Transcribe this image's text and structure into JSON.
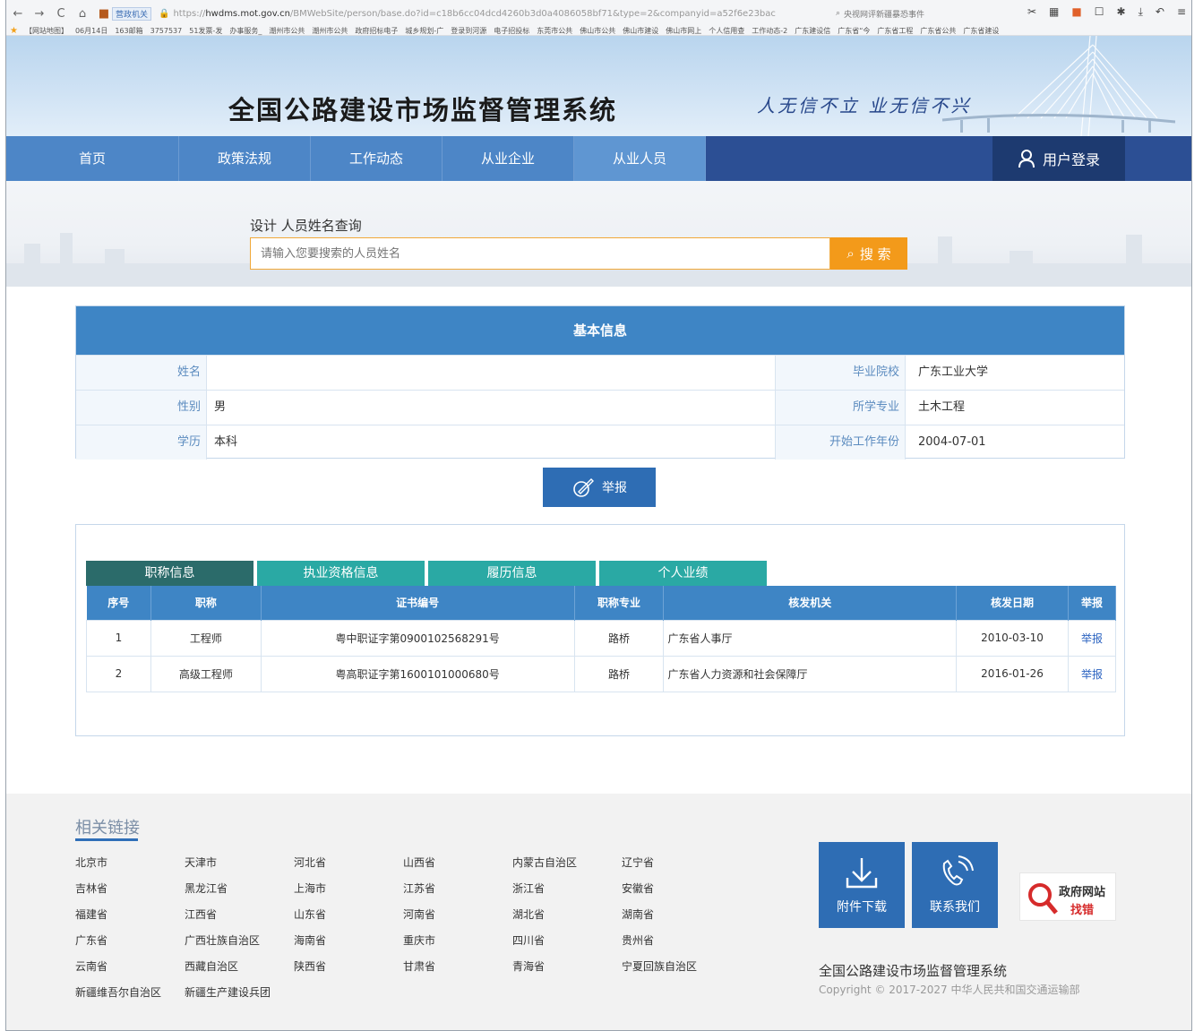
{
  "browser": {
    "url_tag": "营政机关",
    "url_prefix": "https://",
    "url_host": "hwdms.mot.gov.cn",
    "url_rest": "/BMWebSite/person/base.do?id=c18b6cc04dcd4260b3d0a4086058bf71&type=2&companyid=a52f6e23bac",
    "find_text": "央视网评新疆暴恐事件",
    "bookmarks": [
      "【网站地图】",
      "06月14日",
      "163邮箱",
      "3757537",
      "51发票-发",
      "办事服务_",
      "潮州市公共",
      "潮州市公共",
      "政府招标电子",
      "城乡规划-广",
      "登录到河源",
      "电子招投标",
      "东莞市公共",
      "佛山市公共",
      "佛山市建设",
      "佛山市网上",
      "个人信用查",
      "工作动态-2",
      "广东建设信",
      "广东省“今",
      "广东省工程",
      "广东省公共",
      "广东省建设"
    ],
    "colors": {
      "chrome": "#f4f5f7",
      "star": "#f3a11a"
    }
  },
  "header": {
    "title": "全国公路建设市场监督管理系统",
    "slogan": "人无信不立 业无信不兴"
  },
  "nav": {
    "items": [
      {
        "label": "首页"
      },
      {
        "label": "政策法规"
      },
      {
        "label": "工作动态"
      },
      {
        "label": "从业企业"
      },
      {
        "label": "从业人员"
      }
    ],
    "active": "从业人员",
    "login_label": "用户登录",
    "colors": {
      "bar": "#2c4f94",
      "item": "#4d86c7",
      "login": "#1d3a70"
    }
  },
  "search": {
    "label": "设计 人员姓名查询",
    "placeholder": "请输入您要搜索的人员姓名",
    "button_label": "搜 索",
    "colors": {
      "button": "#f39a1a",
      "border": "#f1a839"
    }
  },
  "basic_info": {
    "title": "基本信息",
    "rows": [
      {
        "left_label": "姓名",
        "left_value": "",
        "right_label": "毕业院校",
        "right_value": "广东工业大学"
      },
      {
        "left_label": "性别",
        "left_value": "男",
        "right_label": "所学专业",
        "right_value": "土木工程"
      },
      {
        "left_label": "学历",
        "left_value": "本科",
        "right_label": "开始工作年份",
        "right_value": "2004-07-01"
      }
    ],
    "report_button": "举报"
  },
  "detail_tabs": {
    "tabs": [
      {
        "label": "职称信息"
      },
      {
        "label": "执业资格信息"
      },
      {
        "label": "履历信息"
      },
      {
        "label": "个人业绩"
      }
    ],
    "active": "职称信息",
    "columns": [
      "序号",
      "职称",
      "证书编号",
      "职称专业",
      "核发机关",
      "核发日期",
      "举报"
    ],
    "rows": [
      {
        "no": "1",
        "title": "工程师",
        "cert_no": "粤中职证字第0900102568291号",
        "major": "路桥",
        "issuer": "广东省人事厅",
        "date": "2010-03-10",
        "report": "举报"
      },
      {
        "no": "2",
        "title": "高级工程师",
        "cert_no": "粤高职证字第1600101000680号",
        "major": "路桥",
        "issuer": "广东省人力资源和社会保障厅",
        "date": "2016-01-26",
        "report": "举报"
      }
    ],
    "colors": {
      "tab": "#2aa9a4",
      "tab_active": "#2b6b6a",
      "header": "#3e85c5"
    }
  },
  "footer": {
    "related_title": "相关链接",
    "links": [
      "北京市",
      "天津市",
      "河北省",
      "山西省",
      "内蒙古自治区",
      "辽宁省",
      "吉林省",
      "黑龙江省",
      "上海市",
      "江苏省",
      "浙江省",
      "安徽省",
      "福建省",
      "江西省",
      "山东省",
      "河南省",
      "湖北省",
      "湖南省",
      "广东省",
      "广西壮族自治区",
      "海南省",
      "重庆市",
      "四川省",
      "贵州省",
      "云南省",
      "西藏自治区",
      "陕西省",
      "甘肃省",
      "青海省",
      "宁夏回族自治区",
      "新疆维吾尔自治区",
      "新疆生产建设兵团"
    ],
    "download_label": "附件下载",
    "contact_label": "联系我们",
    "gov_badge_line1": "政府网站",
    "gov_badge_line2": "找错",
    "system_name": "全国公路建设市场监督管理系统",
    "copyright": "Copyright © 2017-2027 中华人民共和国交通运输部"
  }
}
